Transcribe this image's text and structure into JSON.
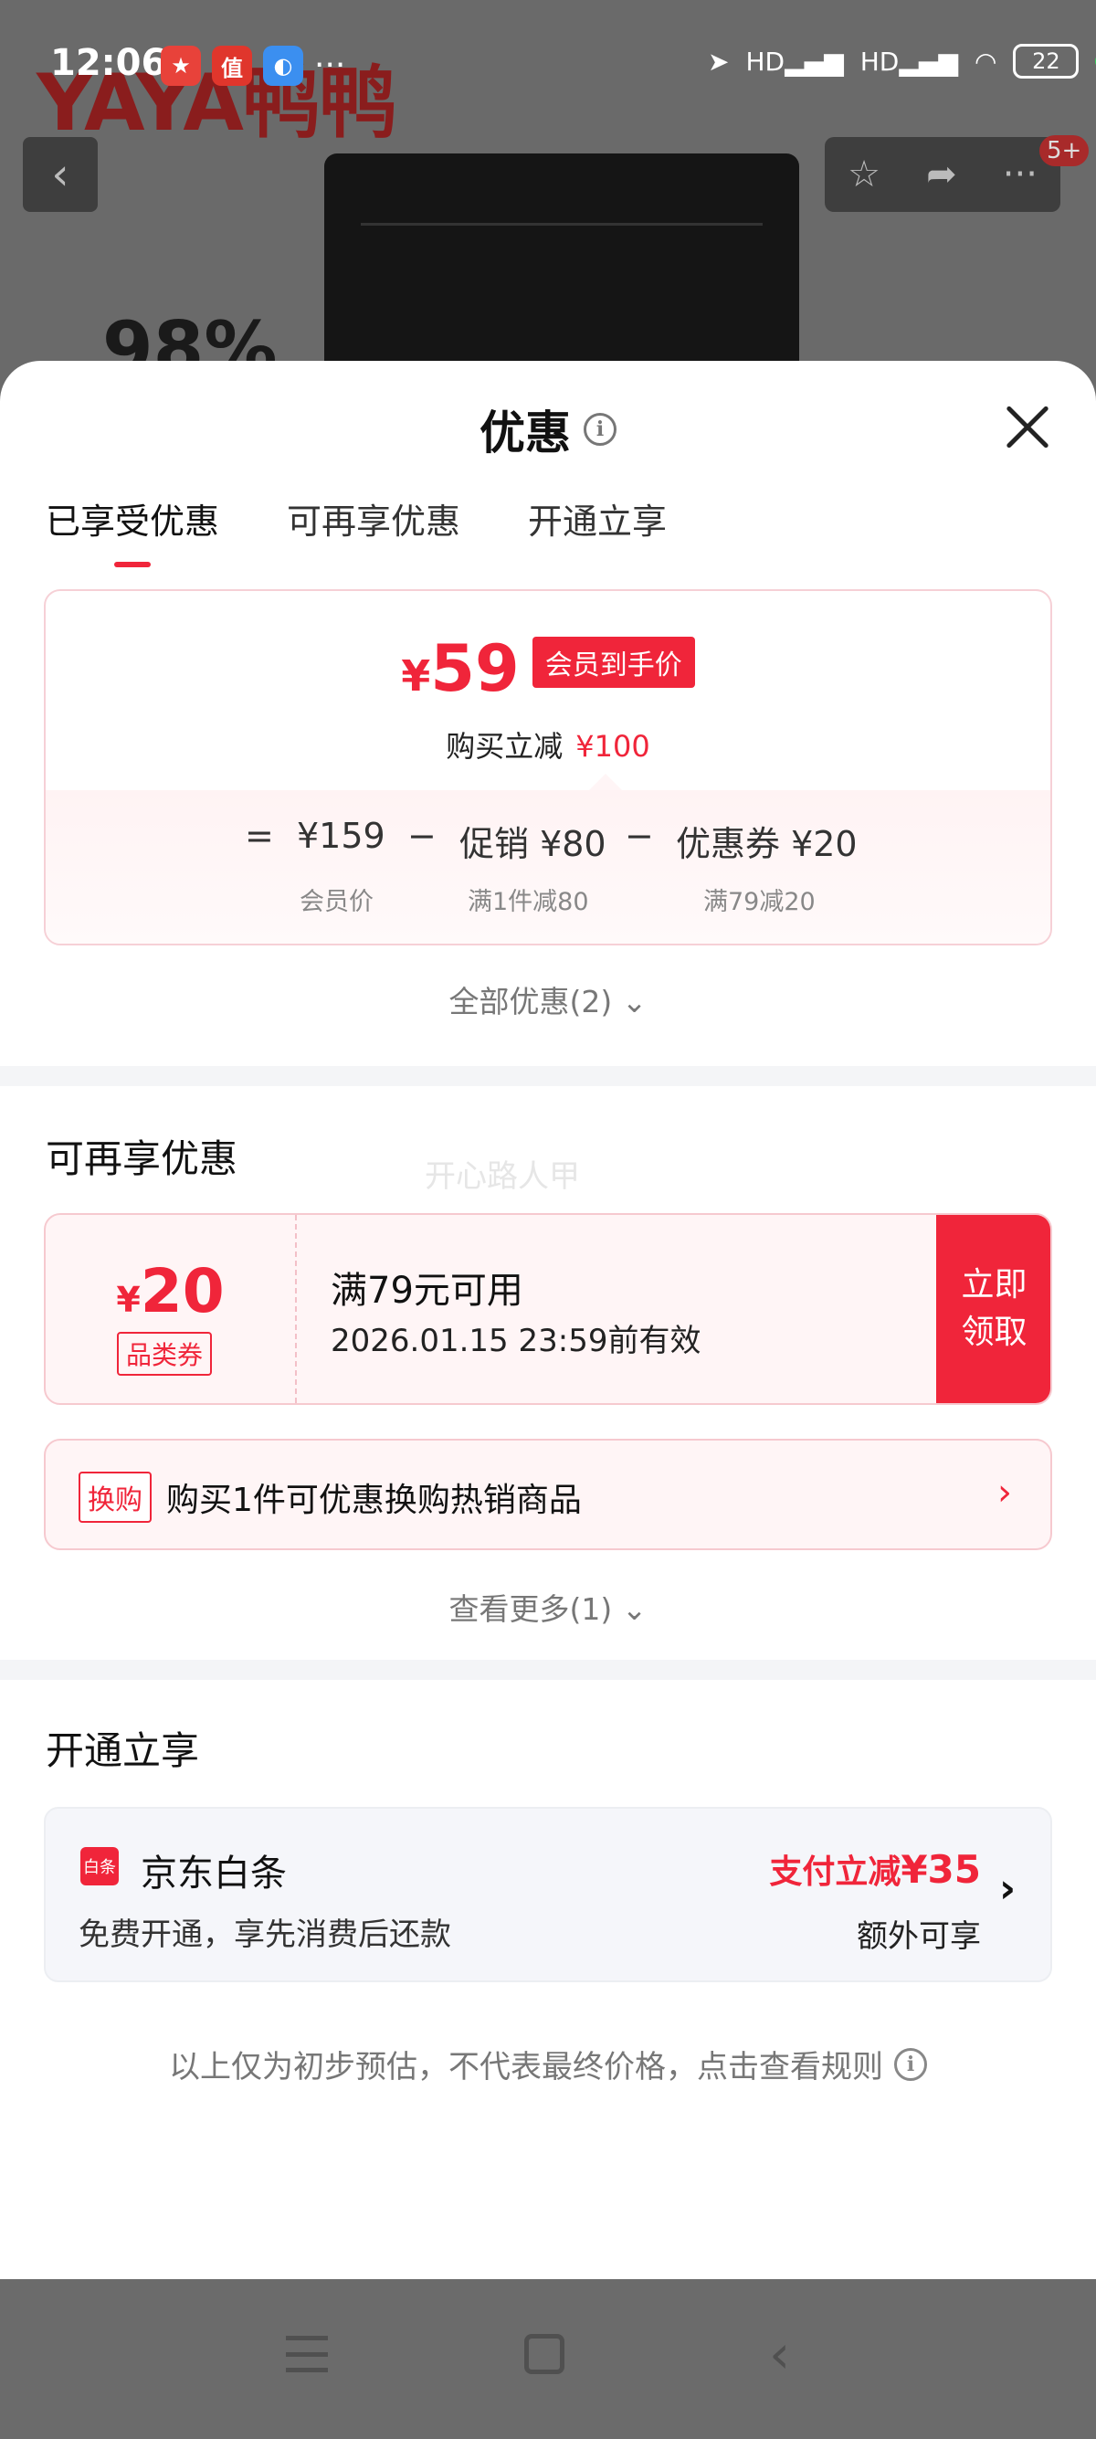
{
  "status_bar": {
    "time": "12:06",
    "battery": "22",
    "signal_label": "HD"
  },
  "background": {
    "brand_logo": "YAYA鸭鸭",
    "percent_text": "98%",
    "notification_badge": "5+"
  },
  "sheet": {
    "title": "优惠",
    "tabs": [
      {
        "label": "已享受优惠",
        "active": true
      },
      {
        "label": "可再享优惠",
        "active": false
      },
      {
        "label": "开通立享",
        "active": false
      }
    ],
    "summary": {
      "currency": "¥",
      "final_price": "59",
      "price_tag": "会员到手价",
      "saving_label": "购买立减",
      "saving_value": "¥100",
      "formula": [
        {
          "operator": "=",
          "value": "¥159",
          "sub": "会员价"
        },
        {
          "operator": "−",
          "value": "促销 ¥80",
          "sub": "满1件减80"
        },
        {
          "operator": "−",
          "value": "优惠券 ¥20",
          "sub": "满79减20"
        }
      ]
    },
    "all_offers_link": "全部优惠(2)",
    "more_section": {
      "title": "可再享优惠",
      "watermark": "开心路人甲",
      "coupon": {
        "currency": "¥",
        "amount": "20",
        "type": "品类券",
        "condition": "满79元可用",
        "validity": "2026.01.15 23:59前有效",
        "button": "立即领取"
      },
      "exchange": {
        "tag": "换购",
        "text": "购买1件可优惠换购热销商品"
      },
      "view_more": "查看更多(1)"
    },
    "open_section": {
      "title": "开通立享",
      "baitiao": {
        "icon_text": "白条",
        "name": "京东白条",
        "desc": "免费开通，享先消费后还款",
        "promo_prefix": "支付立减",
        "promo_value": "¥35",
        "extra": "额外可享"
      }
    },
    "disclaimer": "以上仅为初步预估，不代表最终价格，点击查看规则"
  },
  "colors": {
    "accent_red": "#f0253a",
    "summary_border": "#f6d0d6"
  }
}
